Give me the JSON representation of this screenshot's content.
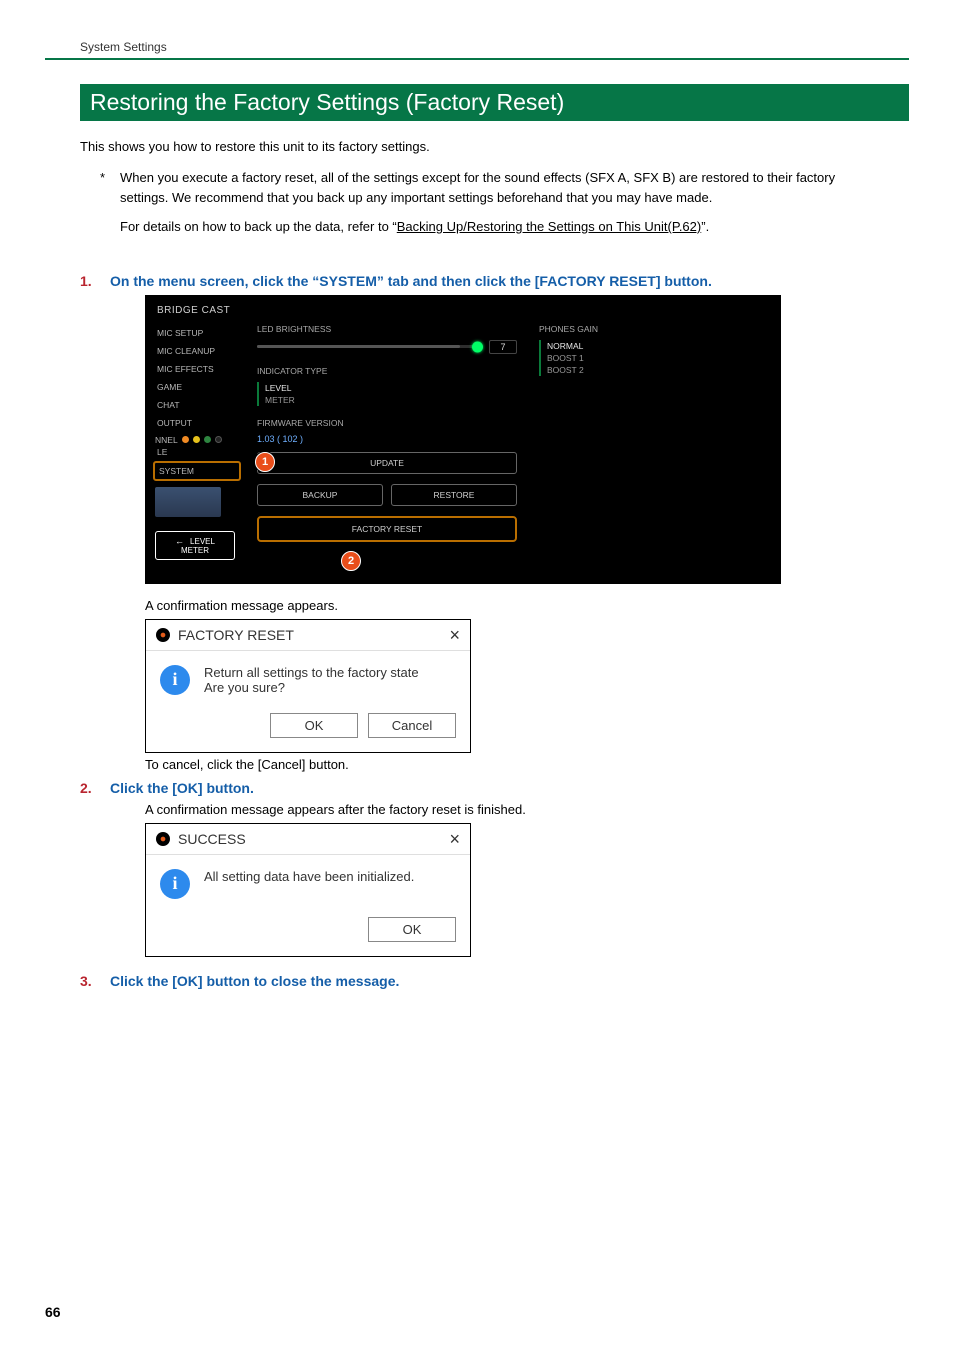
{
  "crumb": "System Settings",
  "h1": "Restoring the Factory Settings (Factory Reset)",
  "intro": "This shows you how to restore this unit to its factory settings.",
  "note_star": "*",
  "note_p1": "When you execute a factory reset, all of the settings except for the sound effects (SFX A, SFX B) are restored to their factory settings. We recommend that you back up any important settings beforehand that you may have made.",
  "note_p2a": "For details on how to back up the data, refer to “",
  "note_link": "Backing Up/Restoring the Settings on This Unit(P.62)",
  "note_p2b": "”.",
  "steps": [
    {
      "num": "1.",
      "txt": "On the menu screen, click the “SYSTEM” tab and then click the [FACTORY RESET] button."
    },
    {
      "num": "2.",
      "txt": "Click the [OK] button."
    },
    {
      "num": "3.",
      "txt": "Click the [OK] button to close the message."
    }
  ],
  "sub_confirm": "A confirmation message appears.",
  "sub_cancel": "To cancel, click the [Cancel] button.",
  "sub_after": "A confirmation message appears after the factory reset is finished.",
  "app": {
    "title": "BRIDGE CAST",
    "sidebar": [
      "MIC SETUP",
      "MIC CLEANUP",
      "MIC EFFECTS",
      "GAME",
      "CHAT",
      "OUTPUT"
    ],
    "sidebar_channel_label": "NNEL",
    "sidebar_file": "LE",
    "sidebar_system": "SYSTEM",
    "level_meter": "LEVEL\nMETER",
    "center": {
      "led_label": "LED BRIGHTNESS",
      "led_value": "7",
      "ind_label": "INDICATOR TYPE",
      "ind_opts": [
        "LEVEL",
        "METER"
      ],
      "fw_label": "FIRMWARE VERSION",
      "fw_value": "1.03 ( 102 )",
      "update": "UPDATE",
      "backup": "BACKUP",
      "restore": "RESTORE",
      "factory_reset": "FACTORY RESET"
    },
    "right": {
      "gain_label": "PHONES GAIN",
      "gain_opts": [
        "NORMAL",
        "BOOST 1",
        "BOOST 2"
      ]
    },
    "badges": {
      "b1": "1",
      "b2": "2"
    }
  },
  "dlg1": {
    "title": "FACTORY RESET",
    "line1": "Return all settings to the factory state",
    "line2": "Are you sure?",
    "ok": "OK",
    "cancel": "Cancel"
  },
  "dlg2": {
    "title": "SUCCESS",
    "msg": "All setting data have been initialized.",
    "ok": "OK"
  },
  "page_num": "66"
}
